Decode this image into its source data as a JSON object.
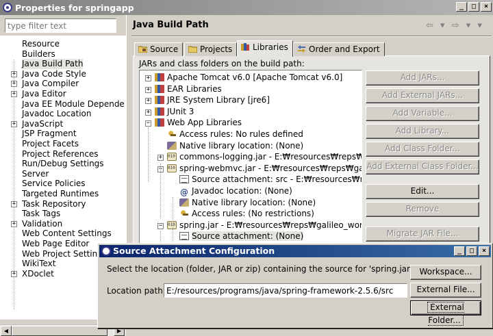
{
  "window": {
    "title": "Properties for springapp",
    "controls": [
      "_",
      "□",
      "×"
    ]
  },
  "filter": {
    "placeholder": "type filter text"
  },
  "pref_tree": [
    {
      "label": "Resource",
      "expandable": false
    },
    {
      "label": "Builders",
      "expandable": false
    },
    {
      "label": "Java Build Path",
      "expandable": false,
      "selected": true
    },
    {
      "label": "Java Code Style",
      "expandable": true
    },
    {
      "label": "Java Compiler",
      "expandable": true
    },
    {
      "label": "Java Editor",
      "expandable": true
    },
    {
      "label": "Java EE Module Depende",
      "expandable": false
    },
    {
      "label": "Javadoc Location",
      "expandable": false
    },
    {
      "label": "JavaScript",
      "expandable": true
    },
    {
      "label": "JSP Fragment",
      "expandable": false
    },
    {
      "label": "Project Facets",
      "expandable": false
    },
    {
      "label": "Project References",
      "expandable": false
    },
    {
      "label": "Run/Debug Settings",
      "expandable": false
    },
    {
      "label": "Server",
      "expandable": false
    },
    {
      "label": "Service Policies",
      "expandable": false
    },
    {
      "label": "Targeted Runtimes",
      "expandable": false
    },
    {
      "label": "Task Repository",
      "expandable": true
    },
    {
      "label": "Task Tags",
      "expandable": false
    },
    {
      "label": "Validation",
      "expandable": true
    },
    {
      "label": "Web Content Settings",
      "expandable": false
    },
    {
      "label": "Web Page Editor",
      "expandable": false
    },
    {
      "label": "Web Project Settings",
      "expandable": false
    },
    {
      "label": "WikiText",
      "expandable": false
    },
    {
      "label": "XDoclet",
      "expandable": true
    }
  ],
  "page": {
    "title": "Java Build Path",
    "nav": "⇦ ▾ ⇨ ▾ ▾"
  },
  "tabs": [
    {
      "label": "Source",
      "active": false
    },
    {
      "label": "Projects",
      "active": false
    },
    {
      "label": "Libraries",
      "active": true
    },
    {
      "label": "Order and Export",
      "active": false
    }
  ],
  "libraries": {
    "caption": "JARs and class folders on the build path:",
    "items": [
      {
        "label": "Apache Tomcat v6.0 [Apache Tomcat v6.0]",
        "icon": "books",
        "exp": "+"
      },
      {
        "label": "EAR Libraries",
        "icon": "books",
        "exp": "+"
      },
      {
        "label": "JRE System Library [jre6]",
        "icon": "books",
        "exp": "+"
      },
      {
        "label": "JUnit 3",
        "icon": "books",
        "exp": "+"
      },
      {
        "label": "Web App Libraries",
        "icon": "books",
        "exp": "−"
      },
      {
        "label": "Access rules: No rules defined",
        "icon": "key",
        "exp": ""
      },
      {
        "label": "Native library location: (None)",
        "icon": "native",
        "exp": ""
      },
      {
        "label": "commons-logging.jar - E:₩resources₩reps₩g",
        "icon": "jar",
        "exp": "+"
      },
      {
        "label": "spring-webmvc.jar - E:₩resources₩reps₩galile",
        "icon": "jar",
        "exp": "−"
      },
      {
        "label": "Source attachment: src - E:₩resources₩reps₩pro",
        "icon": "doc",
        "exp": ""
      },
      {
        "label": "Javadoc location: (None)",
        "icon": "at",
        "exp": ""
      },
      {
        "label": "Native library location: (None)",
        "icon": "native",
        "exp": ""
      },
      {
        "label": "Access rules: (No restrictions)",
        "icon": "key",
        "exp": ""
      },
      {
        "label": "spring.jar - E:₩resources₩reps₩galileo_works",
        "icon": "jar",
        "exp": "−"
      },
      {
        "label": "Source attachment: (None)",
        "icon": "doc",
        "exp": "",
        "selected": true
      }
    ]
  },
  "buttons": {
    "add_jars": "Add JARs...",
    "add_external_jars": "Add External JARs...",
    "add_variable": "Add Variable...",
    "add_library": "Add Library...",
    "add_class_folder": "Add Class Folder...",
    "add_external_class_folder": "Add External Class Folder...",
    "edit": "Edit...",
    "remove": "Remove",
    "migrate": "Migrate JAR File..."
  },
  "dialog": {
    "title": "Source Attachment Configuration",
    "message": "Select the location (folder, JAR or zip) containing the source for 'spring.jar':",
    "location_label": "Location path:",
    "location_value": "E:/resources/programs/java/spring-framework-2.5.6/src",
    "workspace": "Workspace...",
    "external_file": "External File...",
    "external_folder": "External Folder..."
  }
}
